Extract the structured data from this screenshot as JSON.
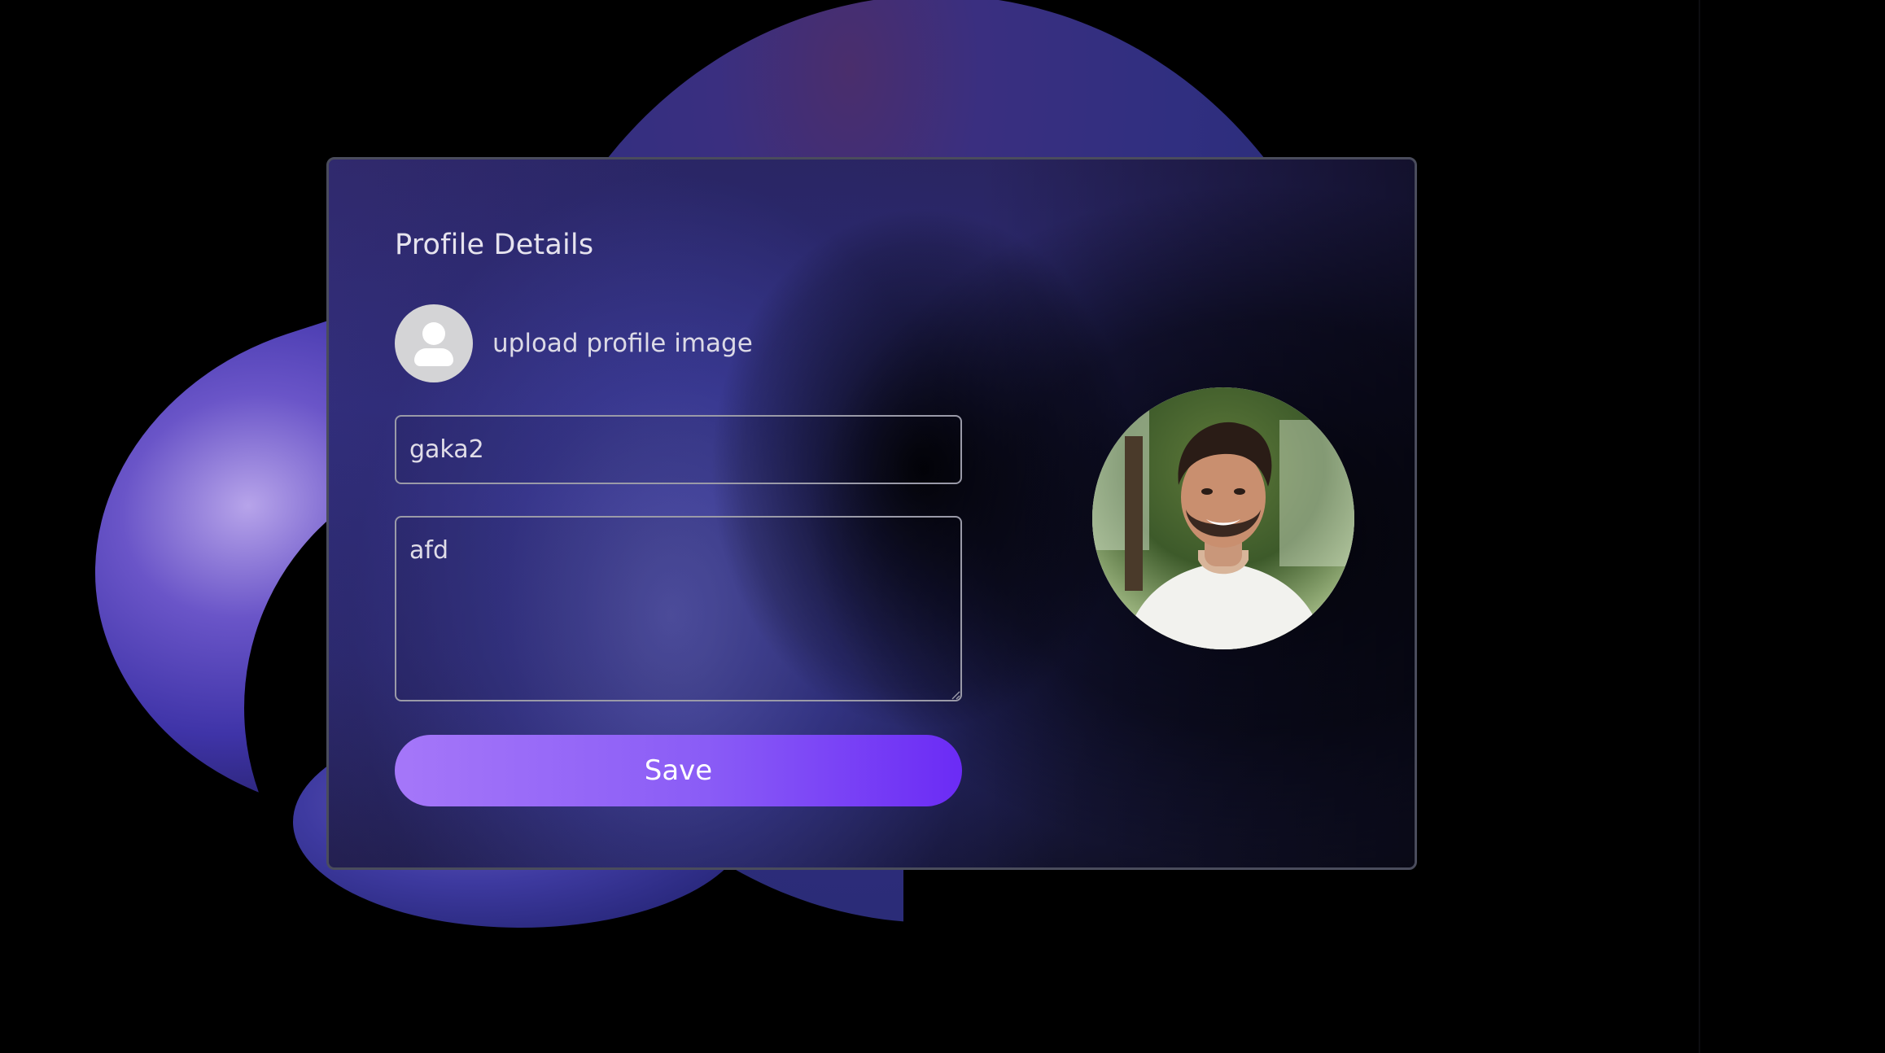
{
  "card": {
    "title": "Profile Details",
    "upload_label": "upload profile image",
    "name_value": "gaka2",
    "bio_value": "afd",
    "save_label": "Save"
  },
  "icons": {
    "avatar_placeholder": "user-silhouette-icon",
    "profile_photo": "profile-photo"
  },
  "colors": {
    "background": "#000000",
    "card_border": "#4a4c5c",
    "button_gradient_start": "#a577f9",
    "button_gradient_end": "#6b2bf5",
    "text": "#e6e3ee"
  }
}
